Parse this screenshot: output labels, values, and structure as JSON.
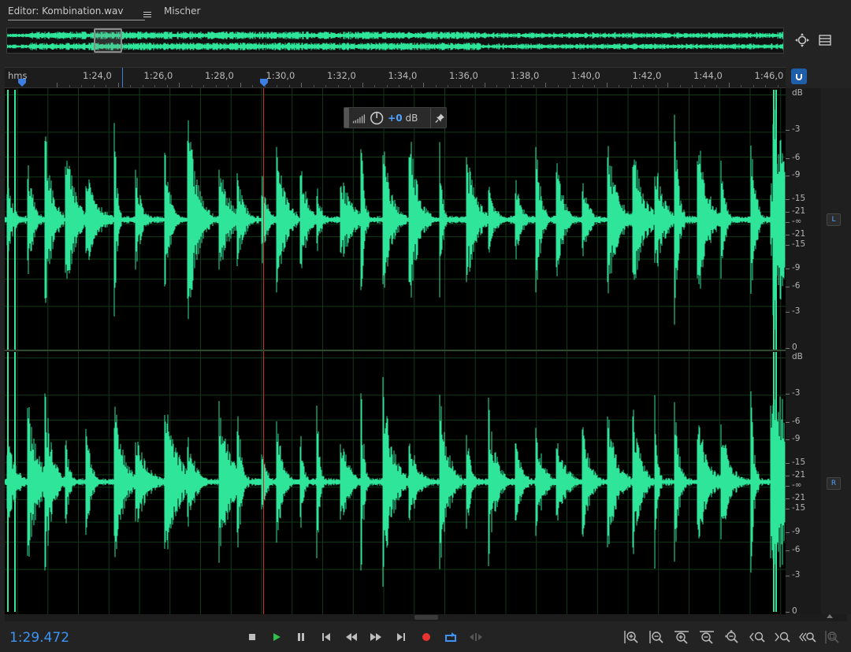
{
  "tabs": {
    "editor_label": "Editor: Kombination.wav",
    "mixer_label": "Mischer"
  },
  "ruler": {
    "unit": "hms",
    "labels": [
      "1:24,0",
      "1:26,0",
      "1:28,0",
      "1:30,0",
      "1:32,0",
      "1:34,0",
      "1:36,0",
      "1:38,0",
      "1:40,0",
      "1:42,0",
      "1:44,0",
      "1:46,0"
    ]
  },
  "hud": {
    "value": "+0",
    "unit": "dB"
  },
  "db_scale": {
    "top_channel_labels": [
      "dB",
      "-3",
      "-6",
      "-9",
      "-15",
      "-21",
      "-∞",
      "-21",
      "-15",
      "-9",
      "-6",
      "-3",
      "0"
    ],
    "bottom_channel_labels": [
      "dB",
      "-3",
      "-6",
      "-9",
      "-15",
      "-21",
      "-∞",
      "-21",
      "-15",
      "-9",
      "-6",
      "-3",
      "0"
    ]
  },
  "channels": {
    "left": "L",
    "right": "R"
  },
  "transport": {
    "current_time": "1:29.472"
  },
  "colors": {
    "waveform": "#2ee59a",
    "accent": "#3d94f6",
    "playhead": "#d62a2a",
    "record": "#e8342f",
    "play": "#2fbf4a"
  },
  "icons": {
    "transport": [
      "stop-icon",
      "play-icon",
      "pause-icon",
      "go-to-start-icon",
      "rewind-icon",
      "fast-forward-icon",
      "go-to-end-icon",
      "record-icon",
      "loop-icon",
      "skip-selection-icon"
    ],
    "zoom": [
      "zoom-in-amplitude-icon",
      "zoom-out-amplitude-icon",
      "zoom-in-time-icon",
      "zoom-out-time-icon",
      "zoom-out-full-icon",
      "zoom-in-start-icon",
      "zoom-in-end-icon",
      "zoom-selection-icon",
      "zoom-tracks-icon"
    ]
  }
}
